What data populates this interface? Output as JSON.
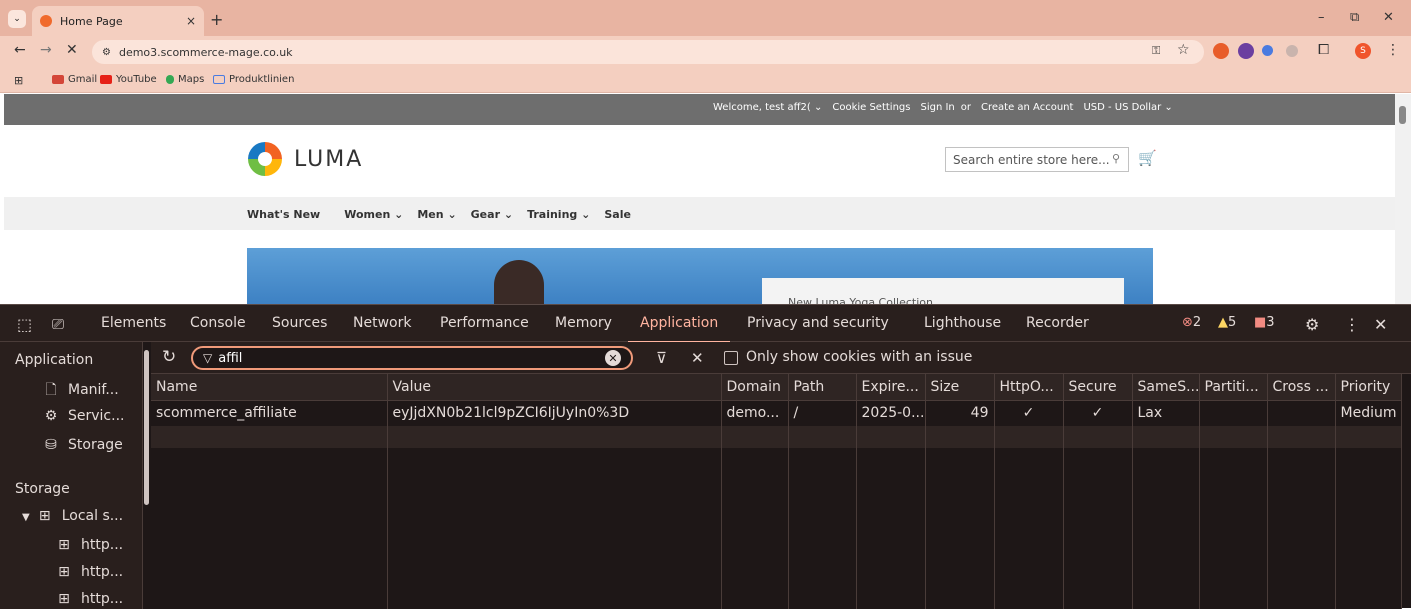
{
  "browser": {
    "tab_title": "Home Page",
    "url": "demo3.scommerce-mage.co.uk",
    "bookmarks": [
      "Gmail",
      "YouTube",
      "Maps",
      "Produktlinien"
    ],
    "profile_initial": "S"
  },
  "site": {
    "topbar": {
      "welcome": "Welcome, test aff2(",
      "cookie_settings": "Cookie Settings",
      "sign_in": "Sign In",
      "or": "or",
      "create_account": "Create an Account",
      "currency": "USD - US Dollar"
    },
    "logo_text": "LUMA",
    "search_placeholder": "Search entire store here...",
    "nav": [
      "What's New",
      "Women",
      "Men",
      "Gear",
      "Training",
      "Sale"
    ],
    "hero_panel_text": "New Luma Yoga Collection"
  },
  "devtools": {
    "tabs": [
      "Elements",
      "Console",
      "Sources",
      "Network",
      "Performance",
      "Memory",
      "Application",
      "Privacy and security",
      "Lighthouse",
      "Recorder"
    ],
    "active_tab": "Application",
    "errors": "2",
    "warnings": "5",
    "issues": "3",
    "sidebar": {
      "section_application": "Application",
      "items_application": [
        "Manif...",
        "Servic...",
        "Storage"
      ],
      "section_storage": "Storage",
      "local_storage": "Local s...",
      "local_children": [
        "http...",
        "http...",
        "http..."
      ]
    },
    "filter": {
      "value": "affil",
      "only_issue_label": "Only show cookies with an issue"
    },
    "table": {
      "columns": [
        "Name",
        "Value",
        "Domain",
        "Path",
        "Expire...",
        "Size",
        "HttpO...",
        "Secure",
        "SameS...",
        "Partiti...",
        "Cross ...",
        "Priority"
      ],
      "rows": [
        {
          "name": "scommerce_affiliate",
          "value": "eyJjdXN0b21lcl9pZCI6IjUyIn0%3D",
          "domain": "demo...",
          "path": "/",
          "expires": "2025-0...",
          "size": "49",
          "httponly": "✓",
          "secure": "✓",
          "samesite": "Lax",
          "partition": "",
          "cross": "",
          "priority": "Medium"
        }
      ]
    }
  }
}
